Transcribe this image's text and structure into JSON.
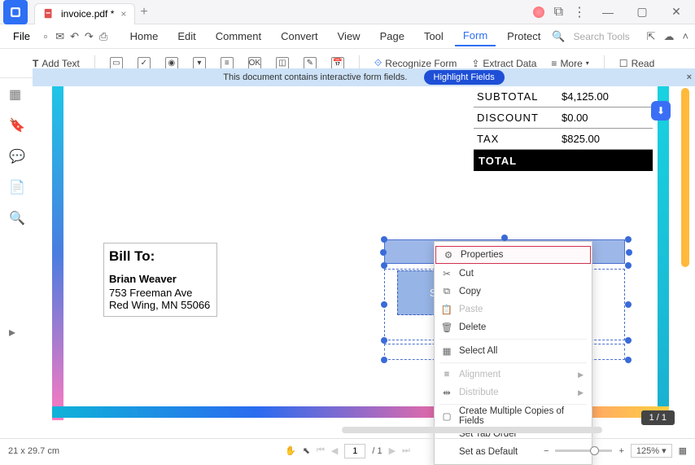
{
  "titlebar": {
    "tab_name": "invoice.pdf *"
  },
  "menubar": {
    "file": "File",
    "items": [
      "Home",
      "Edit",
      "Comment",
      "Convert",
      "View",
      "Page",
      "Tool",
      "Form",
      "Protect"
    ],
    "active": "Form",
    "search_placeholder": "Search Tools"
  },
  "toolbar": {
    "add_text": "Add Text",
    "recognize": "Recognize Form",
    "extract": "Extract Data",
    "more": "More",
    "read": "Read"
  },
  "banner": {
    "msg": "This document contains interactive form fields.",
    "btn": "Highlight Fields"
  },
  "totals": {
    "rows": [
      {
        "label": "SUBTOTAL",
        "value": "$4,125.00"
      },
      {
        "label": "DISCOUNT",
        "value": "$0.00"
      },
      {
        "label": "TAX",
        "value": "$825.00"
      }
    ],
    "total_label": "TOTAL",
    "total_value": ""
  },
  "billto": {
    "heading": "Bill To:",
    "name": "Brian Weaver",
    "addr1": "753 Freeman Ave",
    "addr2": "Red Wing, MN 55066"
  },
  "sign": {
    "label": "Sign He"
  },
  "context_menu": {
    "items": [
      {
        "label": "Properties",
        "highlighted": true
      },
      {
        "label": "Cut"
      },
      {
        "label": "Copy"
      },
      {
        "label": "Paste",
        "disabled": true
      },
      {
        "label": "Delete"
      },
      {
        "sep": true
      },
      {
        "label": "Select All"
      },
      {
        "sep": true
      },
      {
        "label": "Alignment",
        "disabled": true,
        "arrow": true
      },
      {
        "label": "Distribute",
        "disabled": true,
        "arrow": true
      },
      {
        "sep": true
      },
      {
        "label": "Create Multiple Copies of Fields"
      },
      {
        "label": "Set Tab Order"
      },
      {
        "label": "Set as Default"
      }
    ]
  },
  "page_indicator": "1 / 1",
  "statusbar": {
    "dims": "21 x 29.7 cm",
    "page_current": "1",
    "page_total": "/ 1",
    "zoom": "125%"
  }
}
